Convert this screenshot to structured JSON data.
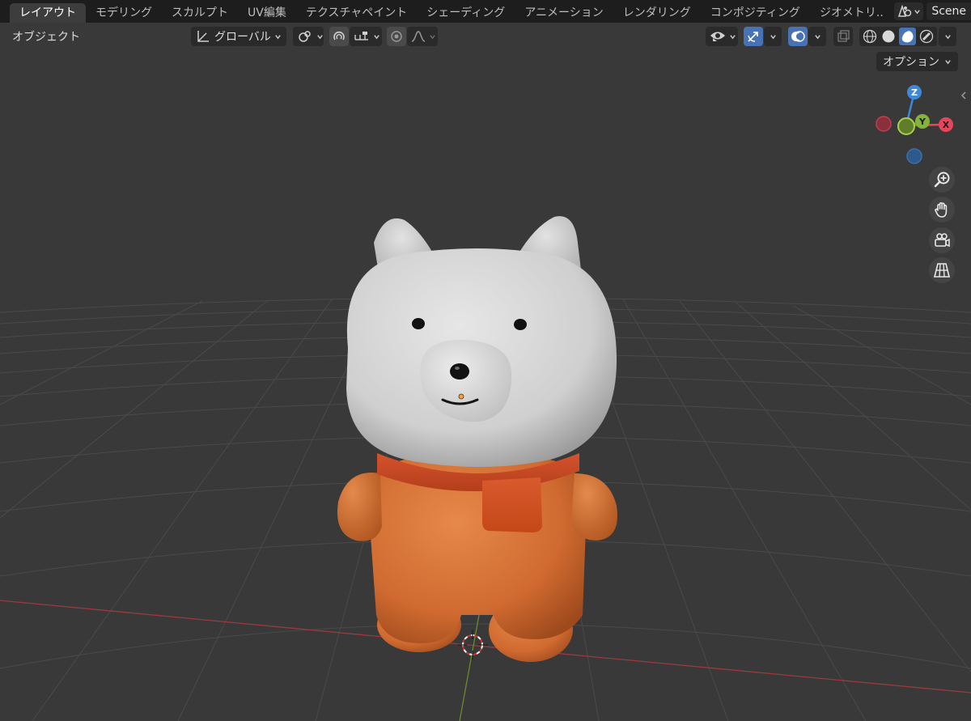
{
  "workspace_tabs": [
    {
      "label": "レイアウト",
      "active": true
    },
    {
      "label": "モデリング",
      "active": false
    },
    {
      "label": "スカルプト",
      "active": false
    },
    {
      "label": "UV編集",
      "active": false
    },
    {
      "label": "テクスチャペイント",
      "active": false
    },
    {
      "label": "シェーディング",
      "active": false
    },
    {
      "label": "アニメーション",
      "active": false
    },
    {
      "label": "レンダリング",
      "active": false
    },
    {
      "label": "コンポジティング",
      "active": false
    },
    {
      "label": "ジオメトリ..",
      "active": false
    }
  ],
  "scene": {
    "name": "Scene"
  },
  "header": {
    "object_menu": "オブジェクト",
    "transform_orientation": "グローバル"
  },
  "options_label": "オプション",
  "gizmo": {
    "z": "Z",
    "y": "Y",
    "x": "X"
  },
  "colors": {
    "x_axis": "#e8455b",
    "y_axis": "#84b33a",
    "z_axis": "#3f88d8",
    "accent_blue": "#4772b3",
    "body_orange": "#d86e33",
    "scarf_red": "#cc4a26",
    "head_white": "#dcdcdc"
  },
  "viewport_shading": {
    "selected": "material-preview"
  }
}
